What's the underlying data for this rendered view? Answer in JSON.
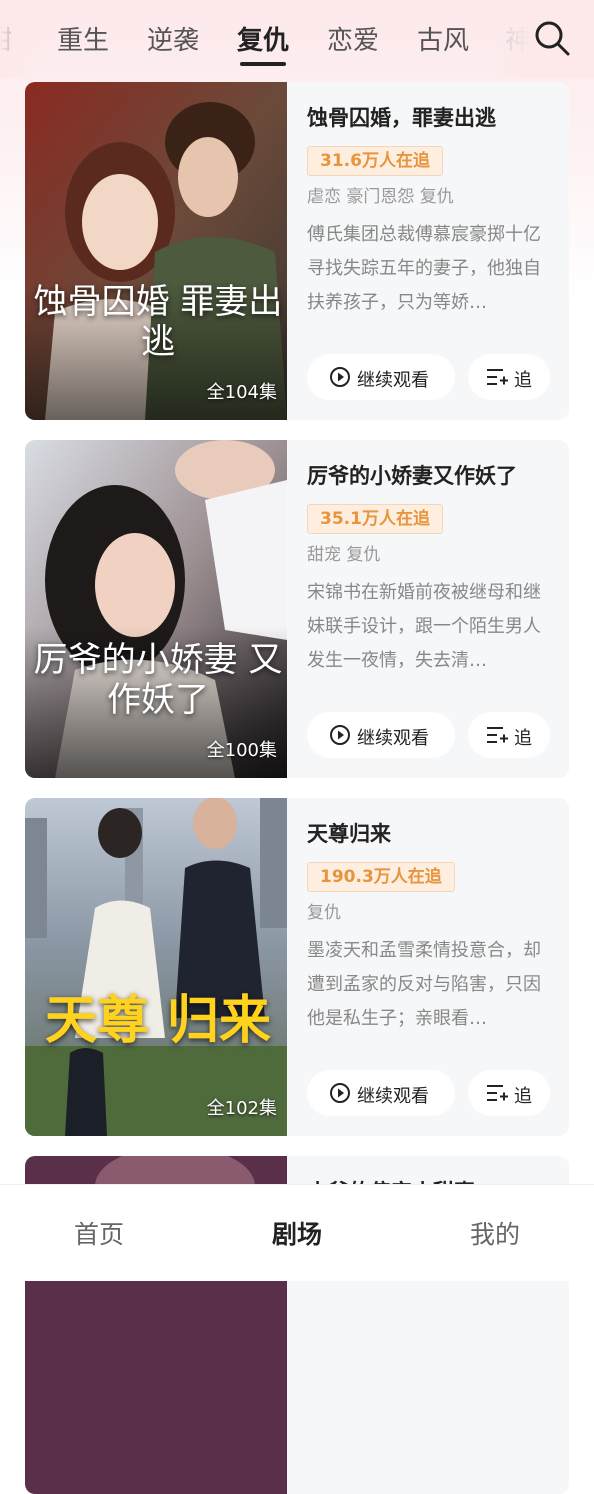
{
  "tabs": {
    "items": [
      "甜",
      "重生",
      "逆袭",
      "复仇",
      "恋爱",
      "古风",
      "神"
    ],
    "active_index": 3
  },
  "cards": [
    {
      "title": "蚀骨囚婚，罪妻出逃",
      "followers": "31.6万人在追",
      "tags": "虐恋 豪门恩怨 复仇",
      "description": "傅氏集团总裁傅慕宸豪掷十亿寻找失踪五年的妻子，他独自扶养孩子，只为等娇…",
      "episodes": "全104集",
      "poster_title": "蚀骨囚婚 罪妻出逃",
      "watch_label": "继续观看",
      "follow_label": "追"
    },
    {
      "title": "厉爷的小娇妻又作妖了",
      "followers": "35.1万人在追",
      "tags": "甜宠 复仇",
      "description": "宋锦书在新婚前夜被继母和继妹联手设计，跟一个陌生男人发生一夜情，失去清…",
      "episodes": "全100集",
      "poster_title": "厉爷的小娇妻 又作妖了",
      "watch_label": "继续观看",
      "follow_label": "追"
    },
    {
      "title": "天尊归来",
      "followers": "190.3万人在追",
      "tags": "复仇",
      "description": "墨凌天和孟雪柔情投意合，却遭到孟家的反对与陷害，只因他是私生子；亲眼看…",
      "episodes": "全102集",
      "poster_title": "天尊 归来",
      "watch_label": "继续观看",
      "follow_label": "追"
    },
    {
      "title": "小爷的偏宠小甜妻"
    }
  ],
  "bottom_nav": {
    "home": "首页",
    "theater": "剧场",
    "mine": "我的"
  },
  "colors": {
    "accent_badge_text": "#e8943c",
    "accent_badge_bg": "#fdeee0"
  }
}
